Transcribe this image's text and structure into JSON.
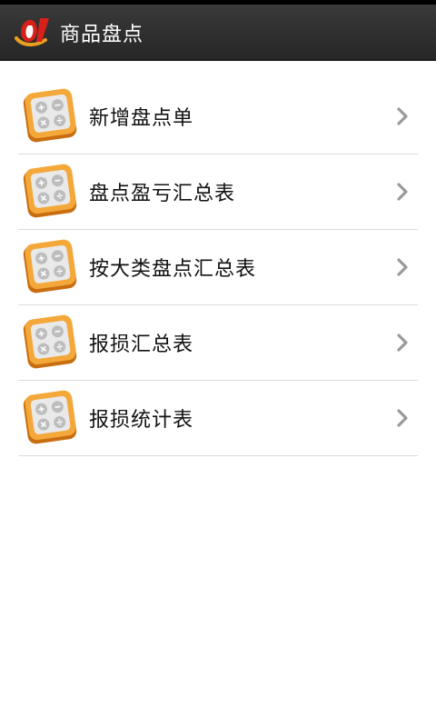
{
  "header": {
    "title": "商品盘点",
    "logo_icon": "app-logo-icon"
  },
  "menu": {
    "items": [
      {
        "label": "新增盘点单",
        "icon": "calculator-icon"
      },
      {
        "label": "盘点盈亏汇总表",
        "icon": "calculator-icon"
      },
      {
        "label": "按大类盘点汇总表",
        "icon": "calculator-icon"
      },
      {
        "label": "报损汇总表",
        "icon": "calculator-icon"
      },
      {
        "label": "报损统计表",
        "icon": "calculator-icon"
      }
    ]
  },
  "colors": {
    "titlebar": "#2e2e2e",
    "icon_orange": "#f0a030",
    "chevron": "#9a9a9a"
  }
}
